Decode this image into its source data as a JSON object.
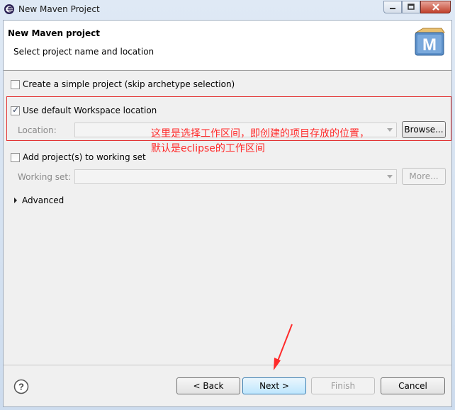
{
  "window": {
    "title": "New Maven Project"
  },
  "header": {
    "title": "New Maven project",
    "subtitle": "Select project name and location"
  },
  "options": {
    "simple_project": {
      "label": "Create a simple project (skip archetype selection)",
      "checked": false
    },
    "default_workspace": {
      "label": "Use default Workspace location",
      "checked": true
    },
    "location": {
      "label": "Location:",
      "value": ""
    },
    "browse_label": "Browse...",
    "working_set": {
      "label": "Add project(s) to working set",
      "checked": false
    },
    "working_set_field": {
      "label": "Working set:",
      "value": ""
    },
    "more_label": "More...",
    "advanced_label": "Advanced"
  },
  "annotation": {
    "line1": "这里是选择工作区间，即创建的项目存放的位置，",
    "line2": "默认是eclipse的工作区间",
    "color": "#ff2a2a"
  },
  "footer": {
    "back": "< Back",
    "next": "Next >",
    "finish": "Finish",
    "cancel": "Cancel"
  },
  "icons": [
    "eclipse-icon",
    "minimize-icon",
    "maximize-icon",
    "close-icon",
    "maven-logo-icon",
    "help-icon",
    "expand-triangle-icon"
  ]
}
